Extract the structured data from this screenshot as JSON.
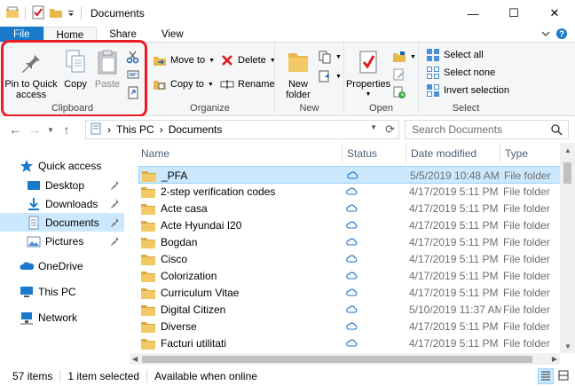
{
  "window": {
    "title": "Documents",
    "minimize_glyph": "—",
    "maximize_glyph": "☐",
    "close_glyph": "✕"
  },
  "tabs": {
    "file": "File",
    "home": "Home",
    "share": "Share",
    "view": "View"
  },
  "ribbon": {
    "clipboard": {
      "label": "Clipboard",
      "pin": "Pin to Quick access",
      "copy": "Copy",
      "paste": "Paste"
    },
    "organize": {
      "label": "Organize",
      "move_to": "Move to",
      "copy_to": "Copy to",
      "delete": "Delete",
      "rename": "Rename"
    },
    "new": {
      "label": "New",
      "new_folder": "New folder"
    },
    "open": {
      "label": "Open",
      "properties": "Properties"
    },
    "select": {
      "label": "Select",
      "select_all": "Select all",
      "select_none": "Select none",
      "invert_selection": "Invert selection"
    }
  },
  "address": {
    "this_pc": "This PC",
    "documents": "Documents",
    "separator": "›"
  },
  "search": {
    "placeholder": "Search Documents"
  },
  "navpane": {
    "items": [
      {
        "label": "Quick access"
      },
      {
        "label": "Desktop"
      },
      {
        "label": "Downloads"
      },
      {
        "label": "Documents"
      },
      {
        "label": "Pictures"
      },
      {
        "label": "OneDrive"
      },
      {
        "label": "This PC"
      },
      {
        "label": "Network"
      }
    ]
  },
  "columns": {
    "name": "Name",
    "status": "Status",
    "date_modified": "Date modified",
    "type": "Type"
  },
  "files": [
    {
      "name": "_PFA",
      "date": "5/5/2019 10:48 AM",
      "type": "File folder"
    },
    {
      "name": "2-step verification codes",
      "date": "4/17/2019 5:11 PM",
      "type": "File folder"
    },
    {
      "name": "Acte casa",
      "date": "4/17/2019 5:11 PM",
      "type": "File folder"
    },
    {
      "name": "Acte Hyundai I20",
      "date": "4/17/2019 5:11 PM",
      "type": "File folder"
    },
    {
      "name": "Bogdan",
      "date": "4/17/2019 5:11 PM",
      "type": "File folder"
    },
    {
      "name": "Cisco",
      "date": "4/17/2019 5:11 PM",
      "type": "File folder"
    },
    {
      "name": "Colorization",
      "date": "4/17/2019 5:11 PM",
      "type": "File folder"
    },
    {
      "name": "Curriculum Vitae",
      "date": "4/17/2019 5:11 PM",
      "type": "File folder"
    },
    {
      "name": "Digital Citizen",
      "date": "5/10/2019 11:37 AM",
      "type": "File folder"
    },
    {
      "name": "Diverse",
      "date": "4/17/2019 5:11 PM",
      "type": "File folder"
    },
    {
      "name": "Facturi utilitati",
      "date": "4/17/2019 5:11 PM",
      "type": "File folder"
    }
  ],
  "status": {
    "count": "57 items",
    "selected": "1 item selected",
    "availability": "Available when online"
  },
  "colors": {
    "accent": "#1979ca",
    "selection": "#cce8ff",
    "highlight_border": "#ea1c24",
    "folder": "#e8b84a",
    "cloud": "#1a73c8"
  }
}
